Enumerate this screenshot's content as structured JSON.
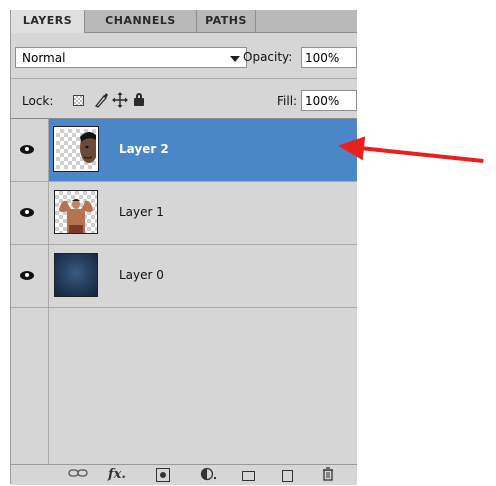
{
  "tabs": [
    {
      "label": "LAYERS",
      "active": true
    },
    {
      "label": "CHANNELS",
      "active": false
    },
    {
      "label": "PATHS",
      "active": false
    }
  ],
  "blend": {
    "mode": "Normal",
    "opacity_label": "Opacity:",
    "opacity_value": "100%"
  },
  "lock": {
    "label": "Lock:",
    "fill_label": "Fill:",
    "fill_value": "100%"
  },
  "layers": [
    {
      "name": "Layer 2",
      "visible": true,
      "selected": true
    },
    {
      "name": "Layer 1",
      "visible": true,
      "selected": false
    },
    {
      "name": "Layer 0",
      "visible": true,
      "selected": false
    }
  ],
  "colors": {
    "selection": "#4a86c8",
    "annotation_arrow": "#e8211e",
    "panel_bg": "#d6d6d6"
  },
  "icons": [
    "eye-icon",
    "link-icon",
    "fx-icon",
    "mask-icon",
    "adjustment-icon",
    "folder-icon",
    "new-layer-icon",
    "trash-icon"
  ]
}
